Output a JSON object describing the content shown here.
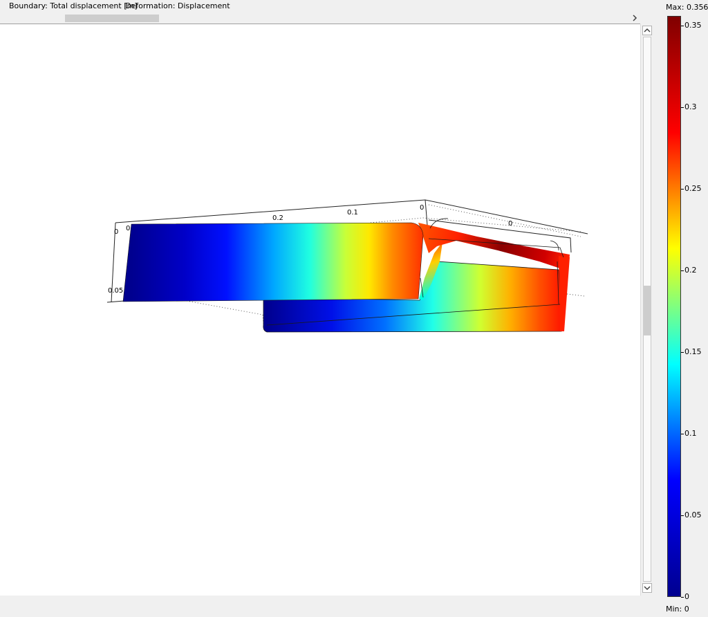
{
  "header": {
    "boundary_text": "Boundary: Total displacement [m]",
    "deformation_text": "Deformation: Displacement"
  },
  "legend": {
    "max_label": "Max: 0.356",
    "min_label": "Min: 0",
    "ticks": [
      {
        "label": "0.35",
        "value": 0.35
      },
      {
        "label": "0.3",
        "value": 0.3
      },
      {
        "label": "0.25",
        "value": 0.25
      },
      {
        "label": "0.2",
        "value": 0.2
      },
      {
        "label": "0.15",
        "value": 0.15
      },
      {
        "label": "0.1",
        "value": 0.1
      },
      {
        "label": "0.05",
        "value": 0.05
      },
      {
        "label": "0",
        "value": 0
      }
    ],
    "range": [
      0,
      0.356
    ],
    "colormap": [
      "#00008f",
      "#0000ff",
      "#00ffff",
      "#ffff00",
      "#ff0000",
      "#800000"
    ]
  },
  "plot": {
    "axis_labels": {
      "zero_left": "0",
      "tick_02": "0.2",
      "tick_01": "0.1",
      "zero_top": "0",
      "zero_right": "0",
      "tick_005": "0.05",
      "tick_0_small": "0"
    }
  },
  "icons": {
    "scroll_right": "chevron-right-icon",
    "scroll_up": "chevron-up-icon",
    "scroll_down": "chevron-down-icon"
  }
}
